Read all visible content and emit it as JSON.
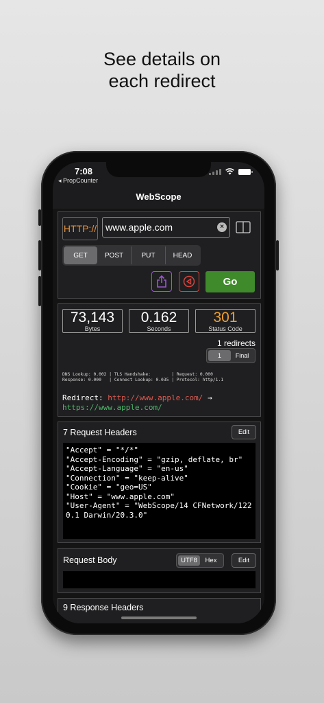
{
  "headline": {
    "line1": "See details on",
    "line2": "each redirect"
  },
  "status_bar": {
    "time": "7:08",
    "back_app": "◂ PropCounter"
  },
  "nav": {
    "title": "WebScope"
  },
  "request": {
    "scheme": "HTTP://",
    "url": "www.apple.com",
    "methods": [
      "GET",
      "POST",
      "PUT",
      "HEAD"
    ],
    "selected_method": "GET",
    "go_label": "Go"
  },
  "stats": {
    "bytes_value": "73,143",
    "bytes_label": "Bytes",
    "seconds_value": "0.162",
    "seconds_label": "Seconds",
    "status_value": "301",
    "status_label": "Status Code",
    "redirect_count": "1 redirects",
    "redirect_tabs": [
      "1",
      "Final"
    ],
    "timing_line1": "DNS Lookup: 0.002 | TLS Handshake:        | Request: 0.000",
    "timing_line2": "Response: 0.000   | Connect Lookup: 0.035 | Protocol: http/1.1",
    "redirect_label": "Redirect:",
    "redirect_from": "http://www.apple.com/",
    "redirect_arrow": "→",
    "redirect_to": "https://www.apple.com/"
  },
  "request_headers": {
    "title": "7 Request Headers",
    "edit_label": "Edit",
    "lines": [
      "\"Accept\" = \"*/*\"",
      "\"Accept-Encoding\" = \"gzip, deflate, br\"",
      "\"Accept-Language\" = \"en-us\"",
      "\"Connection\" = \"keep-alive\"",
      "\"Cookie\" = \"geo=US\"",
      "\"Host\" = \"www.apple.com\"",
      "\"User-Agent\" = \"WebScope/14 CFNetwork/1220.1 Darwin/20.3.0\""
    ]
  },
  "request_body": {
    "title": "Request Body",
    "encodings": [
      "UTF8",
      "Hex"
    ],
    "selected_encoding": "UTF8",
    "edit_label": "Edit"
  },
  "response_headers": {
    "title": "9 Response Headers"
  },
  "colors": {
    "scheme_orange": "#e9923a",
    "status_orange": "#f0a030",
    "go_green": "#3f8a2a",
    "redirect_red": "#e05a50",
    "redirect_green": "#4bb86a",
    "share_purple": "#9b59d0",
    "back_red": "#d9443c"
  }
}
